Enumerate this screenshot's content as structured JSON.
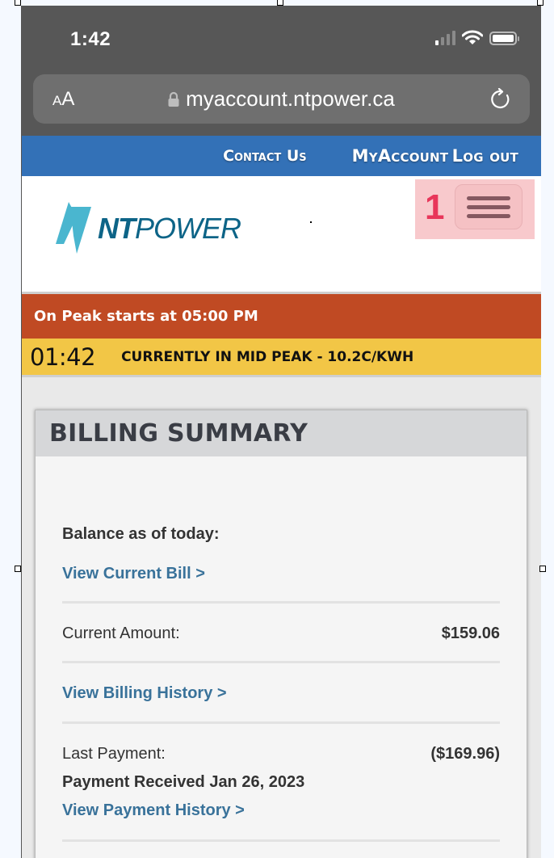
{
  "status_bar": {
    "time": "1:42",
    "icons": [
      "cellular-signal-icon",
      "wifi-icon",
      "battery-icon"
    ]
  },
  "browser": {
    "text_size_label_small": "A",
    "text_size_label_large": "A",
    "url": "myaccount.ntpower.ca",
    "icons": [
      "lock-icon",
      "reload-icon"
    ]
  },
  "top_nav": {
    "contact_label": "Contact Us",
    "myaccount_label": "MyAccount",
    "logout_label": "Log out"
  },
  "header": {
    "logo_bold": "NT",
    "logo_light": "POWER",
    "menu_badge": "1",
    "menu_icon": "hamburger-menu-icon",
    "highlight_color": "#f8c9cc"
  },
  "alerts": {
    "peak_notice": "On Peak starts at 05:00 PM",
    "clock": "01:42",
    "current_rate": "CURRENTLY IN MID PEAK - 10.2C/KWH",
    "peak_color": "#c04a23",
    "mid_color": "#f2c646"
  },
  "billing": {
    "title": "BILLING SUMMARY",
    "balance_label": "Balance as of today:",
    "view_current_bill": "View Current Bill >",
    "current_amount_label": "Current Amount:",
    "current_amount_value": "$159.06",
    "view_billing_history": "View Billing History >",
    "last_payment_label": "Last Payment:",
    "last_payment_value": "($169.96)",
    "payment_received": "Payment Received Jan 26, 2023",
    "view_payment_history": "View Payment History >",
    "link_color": "#39729a"
  }
}
